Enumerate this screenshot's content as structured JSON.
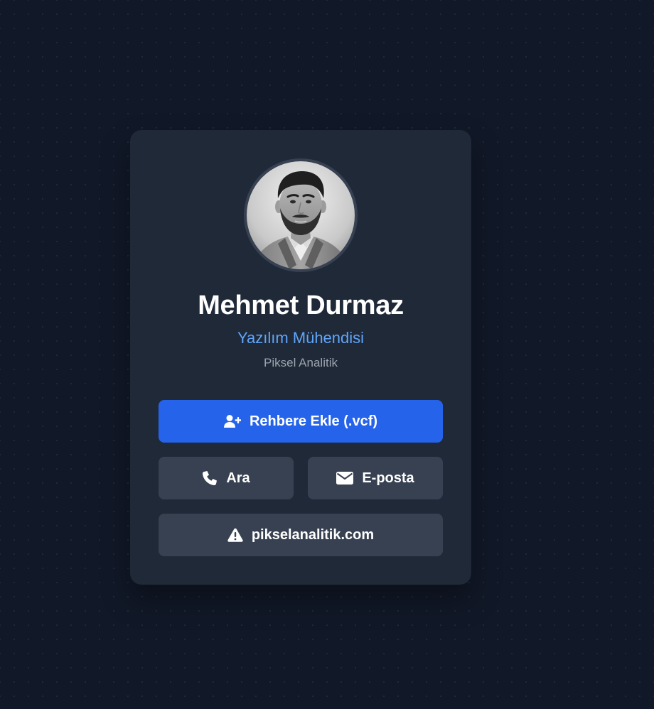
{
  "profile": {
    "name": "Mehmet Durmaz",
    "title": "Yazılım Mühendisi",
    "company": "Piksel Analitik",
    "avatar_icon": "profile-photo"
  },
  "actions": {
    "add_contact": {
      "label": "Rehbere Ekle (.vcf)",
      "icon": "user-plus-icon"
    },
    "call": {
      "label": "Ara",
      "icon": "phone-icon"
    },
    "email": {
      "label": "E-posta",
      "icon": "envelope-icon"
    },
    "website": {
      "label": "pikselanalitik.com",
      "icon": "warning-triangle-icon"
    }
  },
  "colors": {
    "background": "#111827",
    "card": "#1f2937",
    "primary": "#2563eb",
    "secondary_button": "#374151",
    "accent_text": "#60a5fa",
    "muted_text": "#9ca3af"
  }
}
